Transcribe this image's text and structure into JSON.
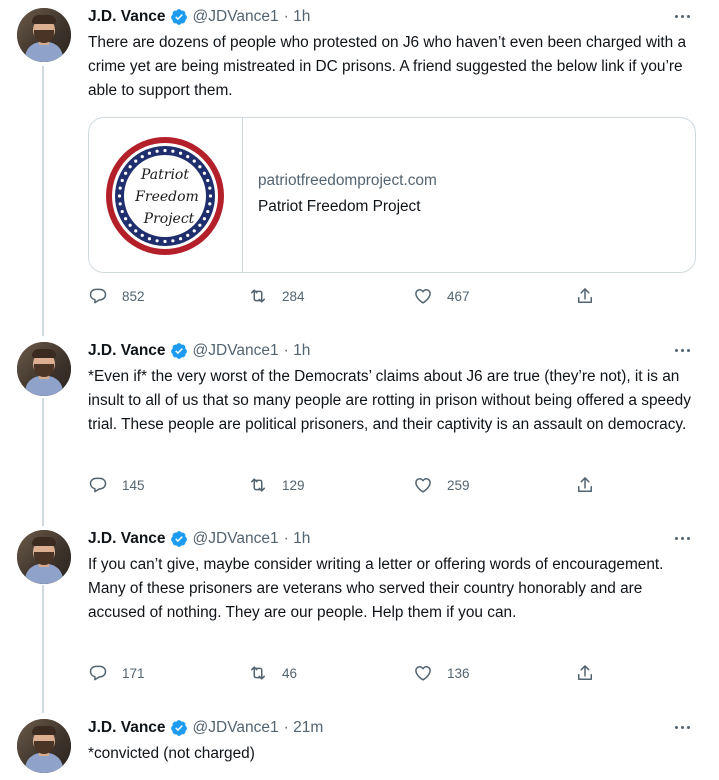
{
  "tweets": [
    {
      "name": "J.D. Vance",
      "handle": "@JDVance1",
      "time": "· 1h",
      "text": "There are dozens of people who protested on J6 who haven’t even been charged with a crime yet are being mistreated in DC prisons. A friend suggested the below link if you’re able to support them.",
      "card": {
        "domain": "patriotfreedomproject.com",
        "title": "Patriot Freedom Project",
        "logo_lines": [
          "Patriot",
          "Freedom",
          "Project"
        ]
      },
      "replies": "852",
      "retweets": "284",
      "likes": "467"
    },
    {
      "name": "J.D. Vance",
      "handle": "@JDVance1",
      "time": "· 1h",
      "text": "*Even if* the very worst of the Democrats’ claims about J6 are true (they’re not), it is an insult to all of us that so many people are rotting in prison without being offered a speedy trial. These people are political prisoners, and their captivity is an assault on democracy.",
      "replies": "145",
      "retweets": "129",
      "likes": "259"
    },
    {
      "name": "J.D. Vance",
      "handle": "@JDVance1",
      "time": "· 1h",
      "text": "If you can’t give, maybe consider writing a letter or offering words of encouragement. Many of these prisoners are veterans who served their country honorably and are accused of nothing. They are our people. Help them if you can.",
      "replies": "171",
      "retweets": "46",
      "likes": "136"
    },
    {
      "name": "J.D. Vance",
      "handle": "@JDVance1",
      "time": "· 21m",
      "text": "*convicted (not charged)"
    }
  ],
  "colors": {
    "verified": "#1d9bf0",
    "muted": "#536471",
    "thread_line": "#cfd9de",
    "logo_red": "#b3202a",
    "logo_blue": "#1f2f6e"
  },
  "icons": [
    "verified-badge-icon",
    "more-options-icon",
    "reply-icon",
    "retweet-icon",
    "like-icon",
    "share-icon"
  ]
}
